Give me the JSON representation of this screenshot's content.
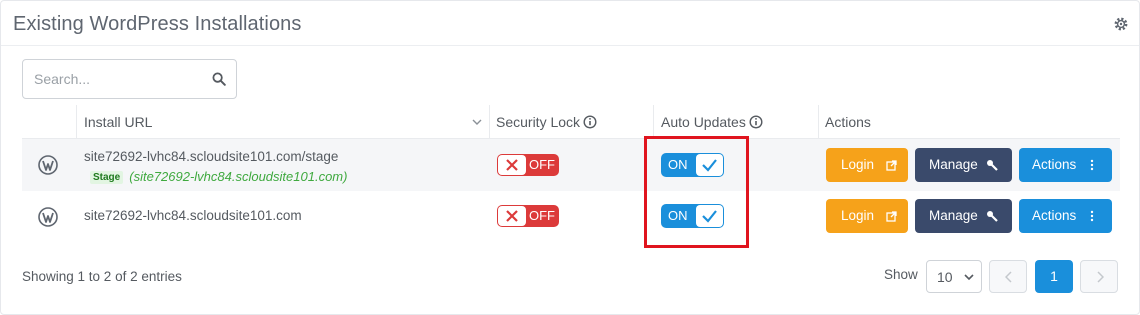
{
  "panel": {
    "title": "Existing WordPress Installations",
    "settings_icon": "gear-icon"
  },
  "search": {
    "placeholder": "Search...",
    "value": ""
  },
  "table": {
    "columns": {
      "install_url": "Install URL",
      "security_lock": "Security Lock",
      "auto_updates": "Auto Updates",
      "actions": "Actions"
    },
    "rows": [
      {
        "url": "site72692-lvhc84.scloudsite101.com/stage",
        "stage_badge": "Stage",
        "stage_url": "(site72692-lvhc84.scloudsite101.com)",
        "security_lock": "OFF",
        "auto_updates": "ON",
        "login": "Login",
        "manage": "Manage",
        "actions": "Actions"
      },
      {
        "url": "site72692-lvhc84.scloudsite101.com",
        "security_lock": "OFF",
        "auto_updates": "ON",
        "login": "Login",
        "manage": "Manage",
        "actions": "Actions"
      }
    ]
  },
  "footer": {
    "info": "Showing 1 to 2 of 2 entries",
    "show_label": "Show",
    "page_size": "10",
    "current_page": "1"
  },
  "colors": {
    "accent_blue": "#1a8fdb",
    "login_orange": "#f6a21a",
    "manage_navy": "#3a4a6b",
    "lock_red": "#dc3a3a",
    "highlight_red": "#e0141e"
  }
}
